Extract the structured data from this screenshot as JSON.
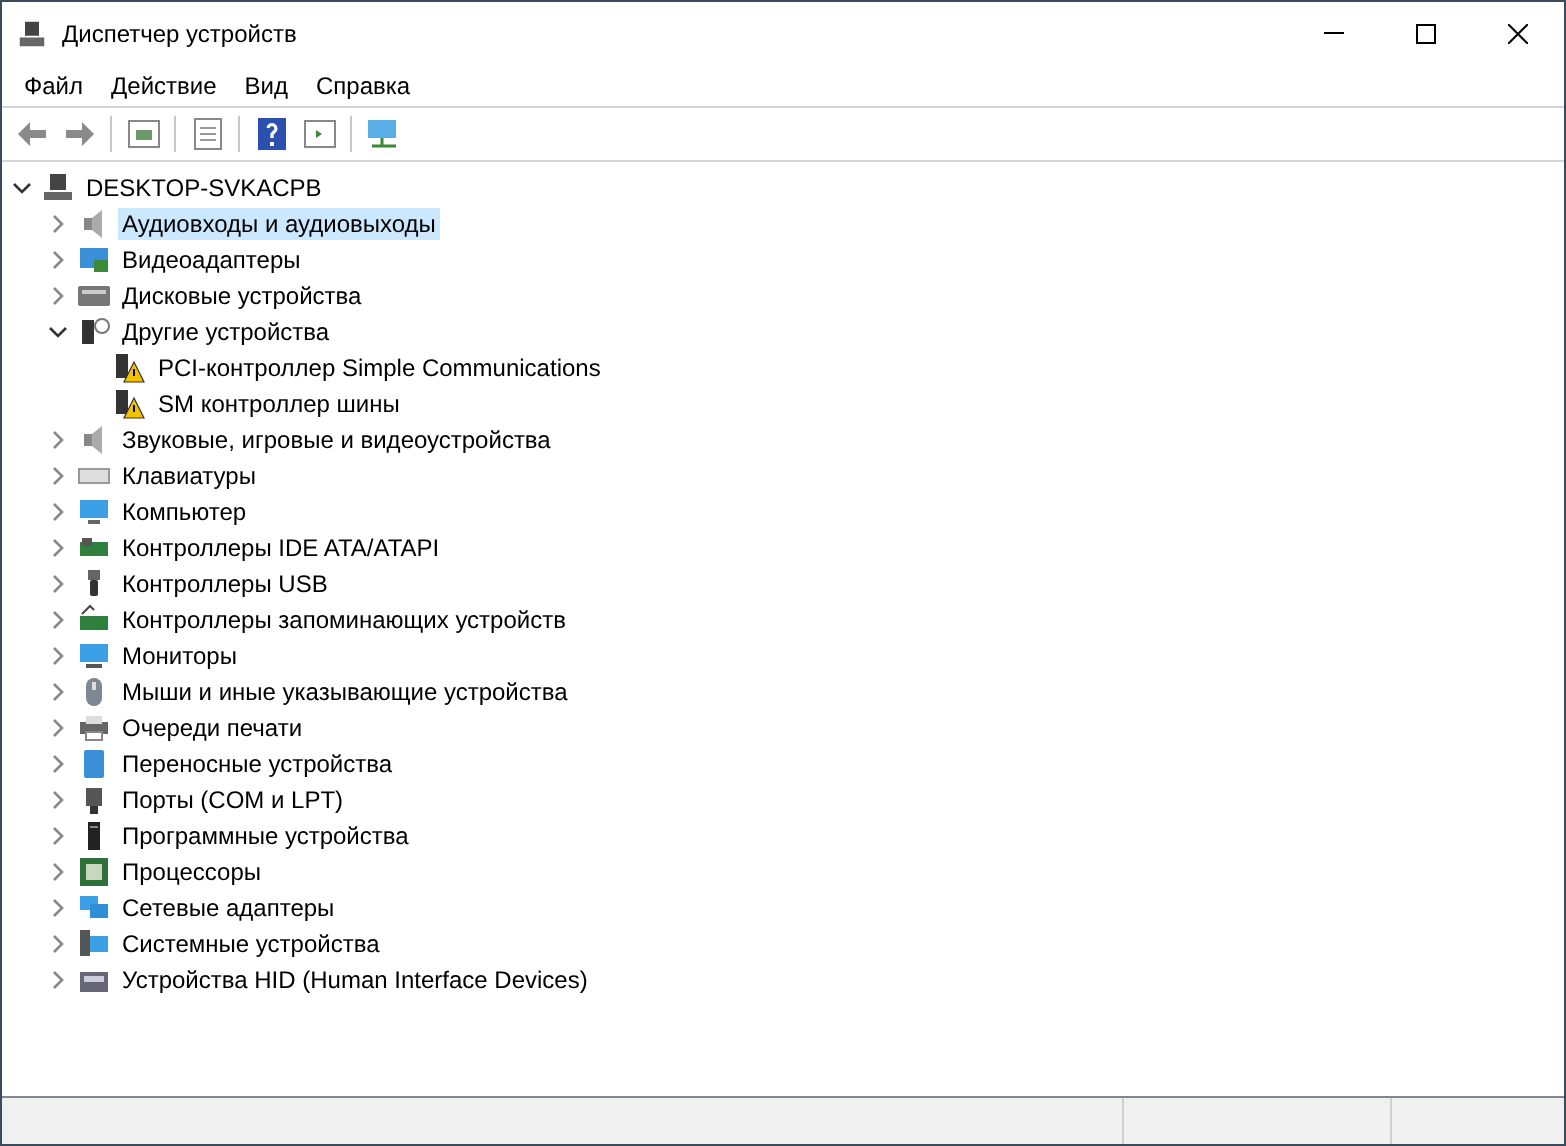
{
  "window": {
    "title": "Диспетчер устройств"
  },
  "menu": [
    {
      "label": "Файл"
    },
    {
      "label": "Действие"
    },
    {
      "label": "Вид"
    },
    {
      "label": "Справка"
    }
  ],
  "tree": {
    "label": "DESKTOP-SVKACPB",
    "expanded": true,
    "selected": false,
    "children": [
      {
        "label": "Аудиовходы и аудиовыходы",
        "expanded": false,
        "selected": true
      },
      {
        "label": "Видеоадаптеры",
        "expanded": false,
        "selected": false
      },
      {
        "label": "Дисковые устройства",
        "expanded": false,
        "selected": false
      },
      {
        "label": "Другие устройства",
        "expanded": true,
        "selected": false,
        "children": [
          {
            "label": "PCI-контроллер Simple Communications",
            "selected": false,
            "warning": true
          },
          {
            "label": "SM контроллер шины",
            "selected": false,
            "warning": true
          }
        ]
      },
      {
        "label": "Звуковые, игровые и видеоустройства",
        "expanded": false,
        "selected": false
      },
      {
        "label": "Клавиатуры",
        "expanded": false,
        "selected": false
      },
      {
        "label": "Компьютер",
        "expanded": false,
        "selected": false
      },
      {
        "label": "Контроллеры IDE ATA/ATAPI",
        "expanded": false,
        "selected": false
      },
      {
        "label": "Контроллеры USB",
        "expanded": false,
        "selected": false
      },
      {
        "label": "Контроллеры запоминающих устройств",
        "expanded": false,
        "selected": false
      },
      {
        "label": "Мониторы",
        "expanded": false,
        "selected": false
      },
      {
        "label": "Мыши и иные указывающие устройства",
        "expanded": false,
        "selected": false
      },
      {
        "label": "Очереди печати",
        "expanded": false,
        "selected": false
      },
      {
        "label": "Переносные устройства",
        "expanded": false,
        "selected": false
      },
      {
        "label": "Порты (COM и LPT)",
        "expanded": false,
        "selected": false
      },
      {
        "label": "Программные устройства",
        "expanded": false,
        "selected": false
      },
      {
        "label": "Процессоры",
        "expanded": false,
        "selected": false
      },
      {
        "label": "Сетевые адаптеры",
        "expanded": false,
        "selected": false
      },
      {
        "label": "Системные устройства",
        "expanded": false,
        "selected": false
      },
      {
        "label": "Устройства HID (Human Interface Devices)",
        "expanded": false,
        "selected": false
      }
    ]
  }
}
